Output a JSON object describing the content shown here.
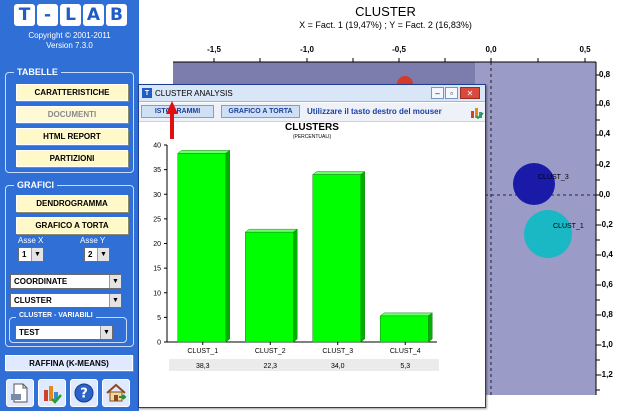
{
  "app": {
    "logo_letters": [
      "T",
      "-",
      "L",
      "A",
      "B"
    ],
    "copyright": "Copyright © 2001-2011",
    "version": "Version 7.3.0"
  },
  "sidebar": {
    "tabelle": {
      "title": "TABELLE",
      "buttons": [
        "CARATTERISTICHE",
        "DOCUMENTI",
        "HTML REPORT",
        "PARTIZIONI"
      ]
    },
    "grafici": {
      "title": "GRAFICI",
      "buttons": [
        "DENDROGRAMMA",
        "GRAFICO A TORTA"
      ],
      "axis_x_label": "Asse X",
      "axis_y_label": "Asse Y",
      "axis_x_value": "1",
      "axis_y_value": "2",
      "coordinate_value": "COORDINATE",
      "cluster_value": "CLUSTER"
    },
    "cluster_variabili": {
      "title": "CLUSTER - VARIABILI",
      "value": "TEST"
    },
    "raffina_label": "RAFFINA (K-MEANS)"
  },
  "plot": {
    "title": "CLUSTER",
    "subtitle": "X = Fact. 1 (19,47%) ; Y = Fact. 2 (16,83%)",
    "x_ticks": [
      "-1,5",
      "-1,0",
      "-0,5",
      "0,0",
      "0,5"
    ],
    "y_ticks": [
      "0,8",
      "0,6",
      "0,4",
      "0,2",
      "0,0",
      "-0,2",
      "-0,4",
      "-0,6",
      "-0,8",
      "-1,0",
      "-1,2"
    ],
    "clusters": [
      {
        "label": "CLUST_3",
        "x": 0.3,
        "y": 0.06,
        "color": "#1a1aa8"
      },
      {
        "label": "CLUST_1",
        "x": 0.32,
        "y": -0.2,
        "color": "#1ab8c4"
      }
    ],
    "bg_color": "#7d7dad"
  },
  "dialog": {
    "title": "CLUSTER ANALYSIS",
    "tabs": [
      "ISTOGRAMMI",
      "GRAFICO A TORTA"
    ],
    "hint": "Utilizzare il tasto destro del mouser"
  },
  "chart_data": {
    "type": "bar",
    "title": "CLUSTERS",
    "subtitle": "(PERCENTUALI)",
    "categories": [
      "CLUST_1",
      "CLUST_2",
      "CLUST_3",
      "CLUST_4"
    ],
    "values": [
      38.3,
      22.3,
      34.0,
      5.3
    ],
    "value_labels": [
      "38,3",
      "22,3",
      "34,0",
      "5,3"
    ],
    "y_ticks": [
      "0",
      "5",
      "10",
      "15",
      "20",
      "25",
      "30",
      "35",
      "40"
    ],
    "ylim": [
      0,
      40
    ],
    "bar_color": "#00ff00"
  }
}
